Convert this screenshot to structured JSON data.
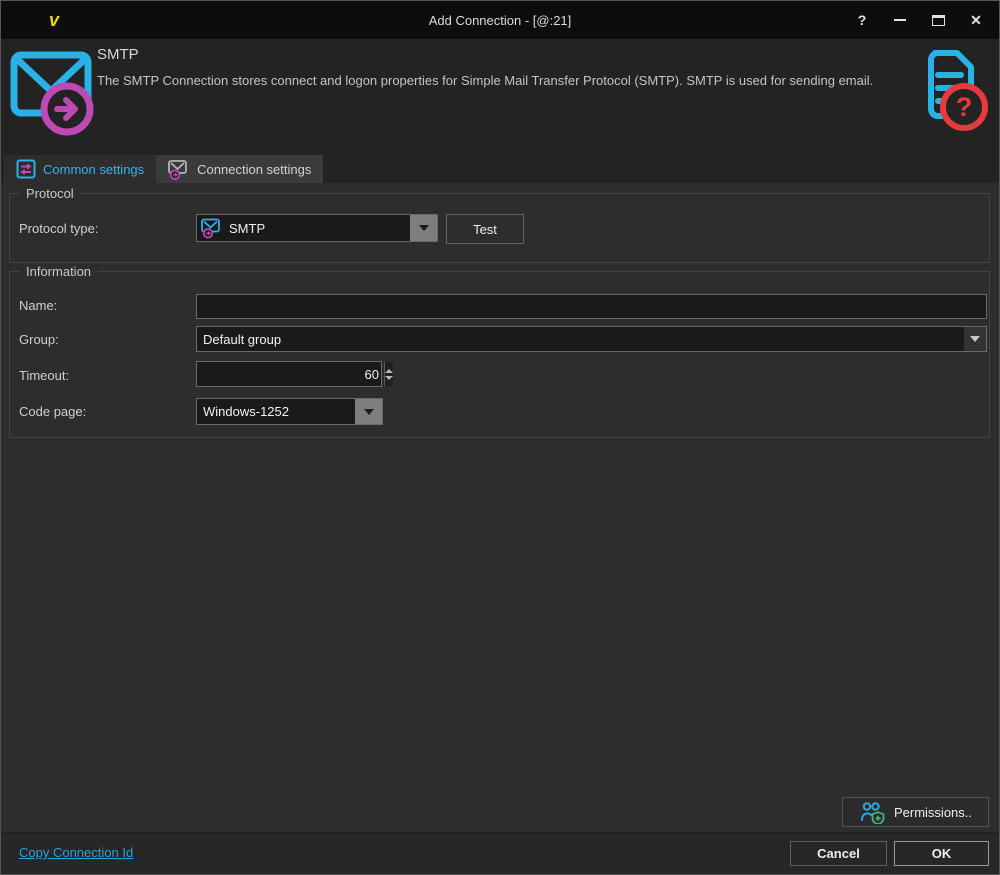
{
  "window": {
    "title": "Add Connection - [@:21]",
    "help_glyph": "?",
    "close_glyph": "✕"
  },
  "header": {
    "title": "SMTP",
    "description": "The SMTP Connection stores connect and logon properties for Simple Mail Transfer Protocol (SMTP). SMTP is used for sending email."
  },
  "tabs": [
    {
      "label": "Common settings",
      "active": true
    },
    {
      "label": "Connection settings",
      "active": false
    }
  ],
  "protocol": {
    "legend": "Protocol",
    "type_label": "Protocol type:",
    "type_value": "SMTP",
    "test_label": "Test"
  },
  "information": {
    "legend": "Information",
    "name_label": "Name:",
    "name_value": "",
    "group_label": "Group:",
    "group_value": "Default group",
    "timeout_label": "Timeout:",
    "timeout_value": "60",
    "codepage_label": "Code page:",
    "codepage_value": "Windows-1252"
  },
  "footer": {
    "permissions_label": "Permissions..",
    "copy_link": "Copy Connection Id",
    "cancel_label": "Cancel",
    "ok_label": "OK"
  },
  "colors": {
    "accent_cyan": "#29b2e5",
    "accent_magenta": "#bd49b4",
    "logo_yellow": "#f2d50f",
    "help_red": "#e8393f",
    "shield_green": "#3dba6f",
    "link_blue": "#2da0d8",
    "active_tab_text": "#2eb7e8"
  }
}
